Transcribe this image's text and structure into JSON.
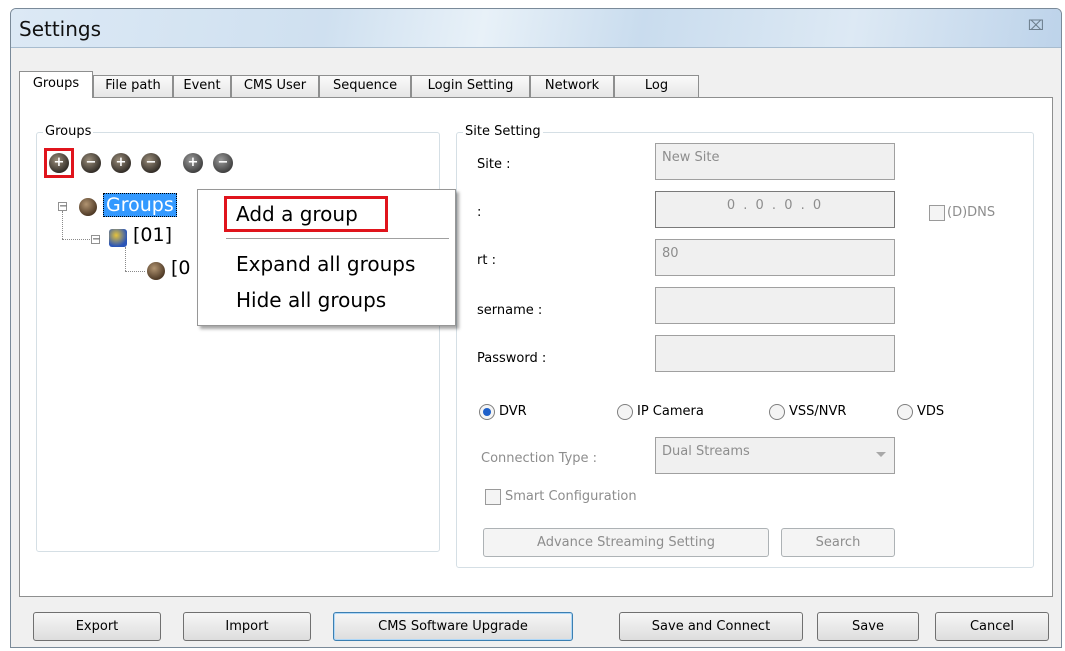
{
  "window": {
    "title": "Settings",
    "close_glyph": "⌧"
  },
  "tabs": [
    {
      "label": "Groups"
    },
    {
      "label": "File path"
    },
    {
      "label": "Event"
    },
    {
      "label": "CMS User"
    },
    {
      "label": "Sequence"
    },
    {
      "label": "Login Setting"
    },
    {
      "label": "Network"
    },
    {
      "label": "Log"
    }
  ],
  "groups_panel": {
    "legend": "Groups",
    "toolbar_icons": [
      "add-group-icon",
      "remove-group-icon",
      "add-site-icon",
      "remove-site-icon",
      "add-channel-icon",
      "remove-channel-icon"
    ],
    "tree": {
      "root_label": "Groups",
      "child_label": "[01]",
      "grandchild_label": "[0"
    }
  },
  "context_menu": {
    "items": [
      "Add a group",
      "Expand all groups",
      "Hide all groups"
    ],
    "highlight_color": "#e0141c"
  },
  "site_setting": {
    "legend": "Site Setting",
    "site_label": "Site :",
    "site_value": "New Site",
    "ip_label": ":",
    "ip_value": "0 . 0 . 0 . 0",
    "ddns_label": "(D)DNS",
    "port_label": "rt :",
    "port_value": "80",
    "username_label": "sername :",
    "password_label": "Password :",
    "device_types": [
      "DVR",
      "IP Camera",
      "VSS/NVR",
      "VDS"
    ],
    "selected_device": "DVR",
    "connection_type_label": "Connection Type :",
    "connection_type_value": "Dual Streams",
    "smart_config_label": "Smart Configuration",
    "advance_button": "Advance Streaming Setting",
    "search_button": "Search"
  },
  "bottom_buttons": {
    "export": "Export",
    "import": "Import",
    "upgrade": "CMS Software Upgrade",
    "save_connect": "Save and Connect",
    "save": "Save",
    "cancel": "Cancel"
  }
}
